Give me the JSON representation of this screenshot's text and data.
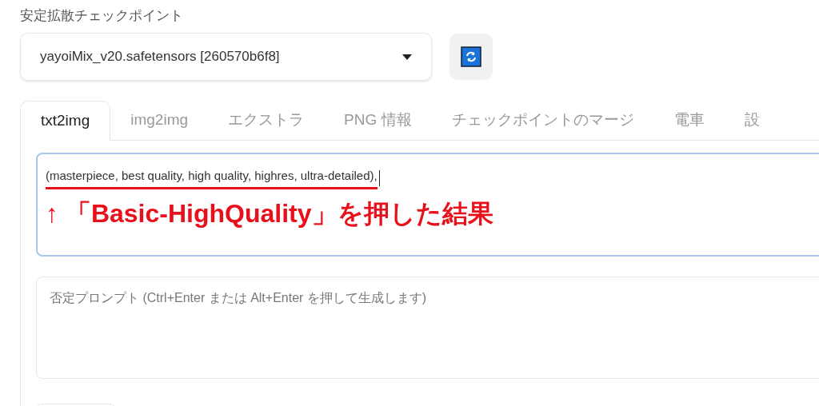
{
  "checkpoint": {
    "label": "安定拡散チェックポイント",
    "value": "yayoiMix_v20.safetensors [260570b6f8]"
  },
  "tabs": [
    {
      "label": "txt2img",
      "selected": true
    },
    {
      "label": "img2img",
      "selected": false
    },
    {
      "label": "エクストラ",
      "selected": false
    },
    {
      "label": "PNG 情報",
      "selected": false
    },
    {
      "label": "チェックポイントのマージ",
      "selected": false
    },
    {
      "label": "電車",
      "selected": false
    },
    {
      "label": "設",
      "selected": false
    }
  ],
  "prompt": {
    "value": "(masterpiece, best quality, high quality, highres, ultra-detailed),"
  },
  "annotation": {
    "text": "↑ 「Basic-HighQuality」を押した結果"
  },
  "negative_prompt": {
    "placeholder": "否定プロンプト (Ctrl+Enter または Alt+Enter を押して生成します)"
  }
}
